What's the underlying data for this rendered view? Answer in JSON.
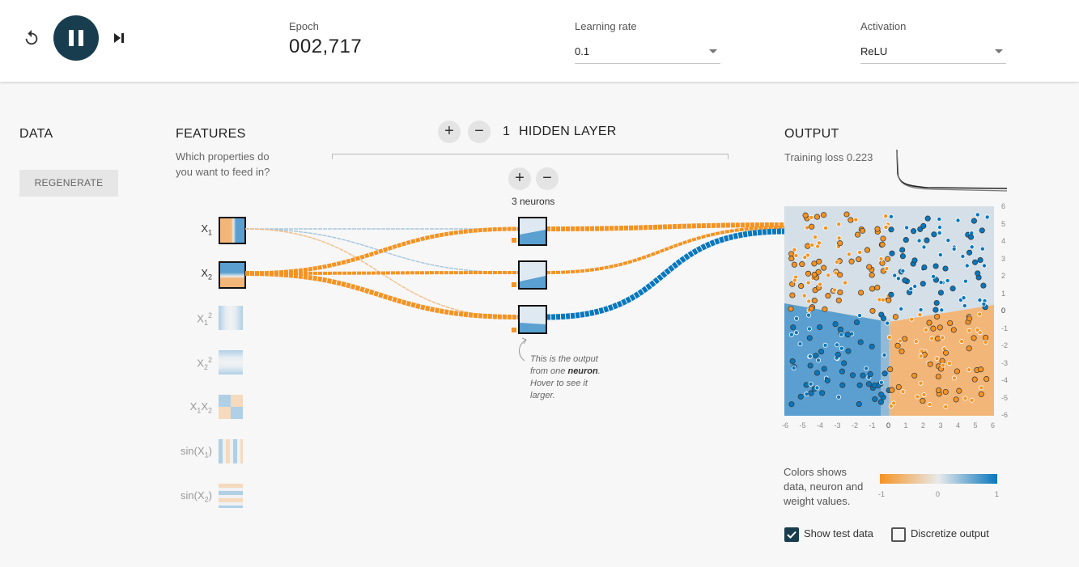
{
  "header": {
    "epoch_label": "Epoch",
    "epoch_value": "002,717",
    "learning_rate_label": "Learning rate",
    "learning_rate_value": "0.1",
    "activation_label": "Activation",
    "activation_value": "ReLU"
  },
  "data_col": {
    "title": "DATA",
    "regenerate_label": "REGENERATE"
  },
  "features_col": {
    "title": "FEATURES",
    "subtitle_1": "Which properties do",
    "subtitle_2": "you want to feed in?"
  },
  "features": [
    {
      "base": "X",
      "sub": "1",
      "sup": "",
      "suffix": "",
      "active": true
    },
    {
      "base": "X",
      "sub": "2",
      "sup": "",
      "suffix": "",
      "active": true
    },
    {
      "base": "X",
      "sub": "1",
      "sup": "2",
      "suffix": "",
      "active": false
    },
    {
      "base": "X",
      "sub": "2",
      "sup": "2",
      "suffix": "",
      "active": false
    },
    {
      "base": "X",
      "sub": "1",
      "sup": "",
      "suffix": "X",
      "sub2": "2",
      "active": false
    },
    {
      "base": "sin(X",
      "sub": "1",
      "sup": "",
      "suffix": ")",
      "active": false
    },
    {
      "base": "sin(X",
      "sub": "2",
      "sup": "",
      "suffix": ")",
      "active": false
    }
  ],
  "hidden": {
    "layer_count": "1",
    "layer_label": "HIDDEN LAYER",
    "plus": "+",
    "minus": "−",
    "neurons_label": "3 neurons",
    "note_1": "This is the output",
    "note_2a": "from one ",
    "note_2b": "neuron",
    "note_2c": ".",
    "note_3": "Hover to see it",
    "note_4": "larger."
  },
  "output_col": {
    "title": "OUTPUT",
    "training_loss_label": "Training loss 0.223",
    "legend_1": "Colors shows",
    "legend_2": "data, neuron and",
    "legend_3": "weight values.",
    "grad_min": "-1",
    "grad_mid": "0",
    "grad_max": "1",
    "show_test_label": "Show test data",
    "show_test_checked": true,
    "discretize_label": "Discretize output",
    "discretize_checked": false
  },
  "axis": {
    "x_ticks": [
      "-6",
      "-5",
      "-4",
      "-3",
      "-2",
      "-1",
      "0",
      "1",
      "2",
      "3",
      "4",
      "5",
      "6"
    ],
    "y_ticks": [
      "6",
      "5",
      "4",
      "3",
      "2",
      "1",
      "0",
      "-1",
      "-2",
      "-3",
      "-4",
      "-5",
      "-6"
    ]
  },
  "colors": {
    "orange": "#f59322",
    "blue": "#0877bd",
    "dark": "#183d4e"
  },
  "icons": {
    "reset": "reset-icon",
    "pause": "pause-icon",
    "step": "step-icon",
    "check": "check-icon"
  }
}
